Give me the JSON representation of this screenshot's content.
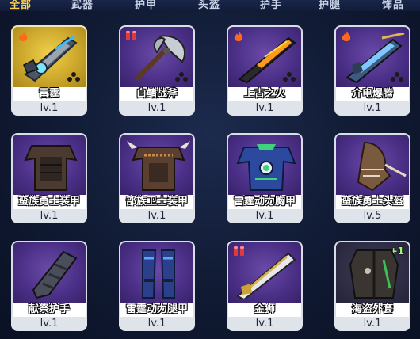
{
  "tabs": [
    {
      "label": "全部",
      "active": true
    },
    {
      "label": "武器",
      "active": false
    },
    {
      "label": "护甲",
      "active": false
    },
    {
      "label": "头盔",
      "active": false
    },
    {
      "label": "护手",
      "active": false
    },
    {
      "label": "护腿",
      "active": false
    },
    {
      "label": "饰品",
      "active": false
    }
  ],
  "items": [
    {
      "name": "雷霆",
      "level": "lv.1",
      "rarity": "gold",
      "badge": "fire-icon",
      "icon": "plasma-rifle-icon",
      "equipped": true
    },
    {
      "name": "白鳍战斧",
      "level": "lv.1",
      "rarity": "purple",
      "badge": "ammo-icon",
      "icon": "axe-icon"
    },
    {
      "name": "上古之火",
      "level": "lv.1",
      "rarity": "purple",
      "badge": "fire-icon",
      "icon": "flame-rifle-icon"
    },
    {
      "name": "介电爆腾",
      "level": "lv.1",
      "rarity": "purple",
      "badge": "fire-icon",
      "icon": "electric-rifle-icon"
    },
    {
      "name": "蛮族勇士装甲",
      "level": "lv.1",
      "rarity": "purple",
      "icon": "leather-armor-icon"
    },
    {
      "name": "部族卫士装甲",
      "level": "lv.1",
      "rarity": "purple",
      "icon": "spiked-armor-icon"
    },
    {
      "name": "雷霆动力胸甲",
      "level": "lv.1",
      "rarity": "purple",
      "icon": "power-chestplate-icon"
    },
    {
      "name": "蛮族勇士头盔",
      "level": "lv.5",
      "rarity": "purple",
      "icon": "leather-helmet-icon"
    },
    {
      "name": "献祭护手",
      "level": "lv.1",
      "rarity": "purple",
      "icon": "gauntlet-icon"
    },
    {
      "name": "雷霆动力腿甲",
      "level": "lv.1",
      "rarity": "purple",
      "icon": "power-leggings-icon"
    },
    {
      "name": "金狮",
      "level": "lv.1",
      "rarity": "purple",
      "badge": "ammo-icon",
      "icon": "lion-rifle-icon"
    },
    {
      "name": "海盗外套",
      "level": "lv.1",
      "rarity": "dark",
      "plus": "+1",
      "icon": "pirate-coat-icon"
    }
  ]
}
